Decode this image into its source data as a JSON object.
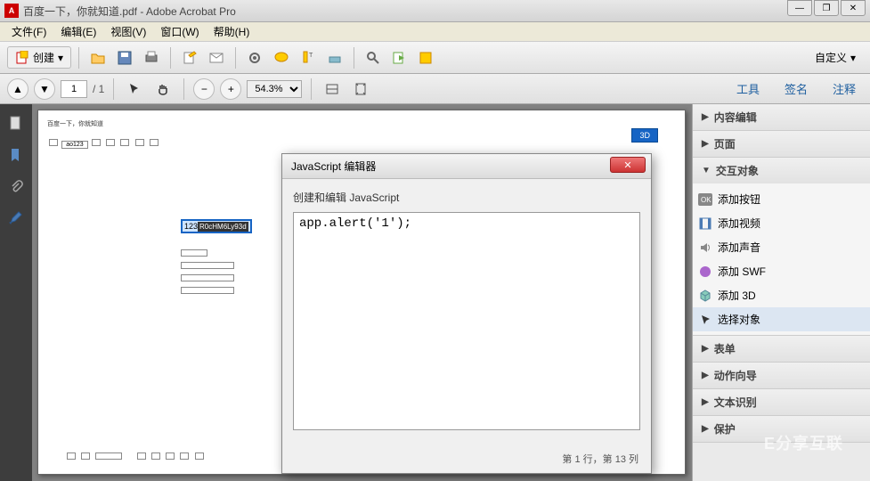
{
  "window": {
    "title": "百度一下，你就知道.pdf - Adobe Acrobat Pro",
    "controls": {
      "min": "—",
      "max": "❐",
      "close": "✕"
    }
  },
  "menu": {
    "file": "文件(F)",
    "edit": "编辑(E)",
    "view": "视图(V)",
    "window": "窗口(W)",
    "help": "帮助(H)"
  },
  "toolbar": {
    "create_label": "创建",
    "custom_label": "自定义"
  },
  "nav": {
    "page_current": "1",
    "page_total": "/ 1",
    "zoom": "54.3%",
    "tabs": {
      "tools": "工具",
      "sign": "签名",
      "comment": "注释"
    }
  },
  "doc": {
    "header": "百度一下，你就知道",
    "field_prefix": "123",
    "field_content": "R0cHM6Ly93d",
    "tag3d": "3D"
  },
  "panel": {
    "sections": {
      "content_edit": "内容编辑",
      "pages": "页面",
      "interactive": "交互对象",
      "forms": "表单",
      "action_wizard": "动作向导",
      "recognition": "文本识别",
      "protection": "保护"
    },
    "interactive_items": {
      "add_button": "添加按钮",
      "add_video": "添加视频",
      "add_sound": "添加声音",
      "add_swf": "添加 SWF",
      "add_3d": "添加 3D",
      "select_object": "选择对象"
    }
  },
  "dialog": {
    "title": "JavaScript 编辑器",
    "subtitle": "创建和编辑 JavaScript",
    "code": "app.alert('1');",
    "status": "第 1 行，第 13 列"
  },
  "watermark": "E分享互联"
}
